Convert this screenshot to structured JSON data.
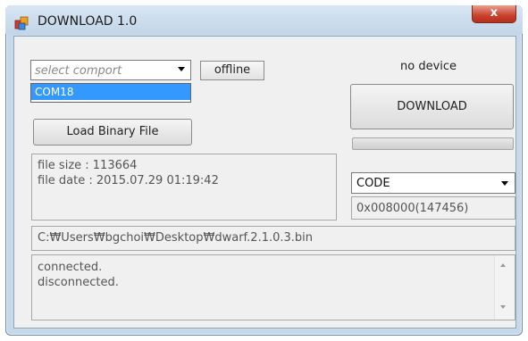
{
  "window": {
    "title": "DOWNLOAD 1.0",
    "close_glyph": "x",
    "icon": "app-icon"
  },
  "comport": {
    "selected_text": "select comport",
    "options": [
      "COM18"
    ],
    "highlighted_option": "COM18"
  },
  "status": {
    "connection_label": "offline",
    "device_label": "no device"
  },
  "buttons": {
    "download": "DOWNLOAD",
    "load_binary": "Load Binary File"
  },
  "progress": {
    "value": 0
  },
  "file_info": {
    "size_line": "file size : 113664",
    "date_line": "file date : 2015.07.29 01:19:42"
  },
  "region": {
    "selected": "CODE",
    "address": "0x008000(147456)"
  },
  "file_path": "C:₩Users₩bgchoi₩Desktop₩dwarf.2.1.0.3.bin",
  "log": {
    "lines": [
      "connected.",
      "disconnected."
    ]
  },
  "colors": {
    "highlight": "#3399ff",
    "close_button": "#c9412b",
    "frame": "#c7d8ea"
  }
}
